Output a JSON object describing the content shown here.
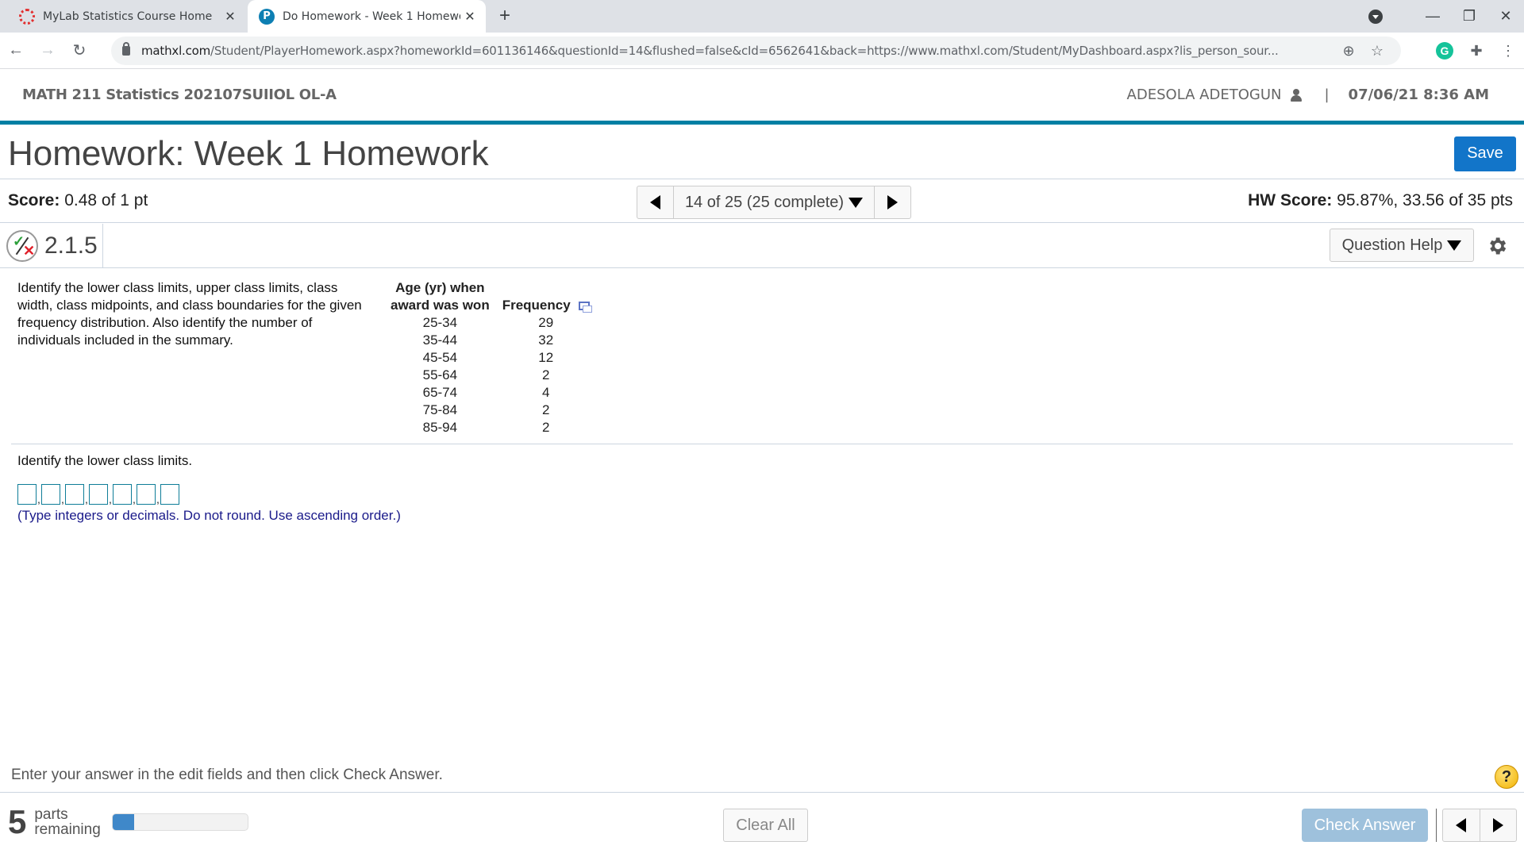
{
  "browser": {
    "tabs": [
      {
        "title": "MyLab Statistics Course Home",
        "icon": "canvas-icon",
        "active": false
      },
      {
        "title": "Do Homework - Week 1 Homework",
        "icon": "pearson-icon",
        "active": true
      }
    ],
    "new_tab": "+",
    "url_host": "mathxl.com",
    "url_path": "/Student/PlayerHomework.aspx?homeworkId=601136146&questionId=14&flushed=false&cId=6562641&back=https://www.mathxl.com/Student/MyDashboard.aspx?lis_person_sour..."
  },
  "course": {
    "name": "MATH 211 Statistics 202107SUIIOL OL-A",
    "user": "ADESOLA ADETOGUN",
    "separator": "|",
    "datetime": "07/06/21 8:36 AM"
  },
  "homework": {
    "title": "Homework: Week 1 Homework",
    "save_label": "Save",
    "score_label": "Score:",
    "score_value": "0.48 of 1 pt",
    "question_selector": "14 of 25 (25 complete)",
    "hw_score_label": "HW Score:",
    "hw_score_value": "95.87%, 33.56 of 35 pts"
  },
  "question": {
    "number": "2.1.5",
    "help_label": "Question Help",
    "stem": "Identify the lower class limits, upper class limits, class width, class midpoints, and class boundaries for the given frequency distribution. Also identify the number of individuals included in the summary.",
    "table": {
      "headers": [
        "Age (yr) when award was won",
        "Frequency"
      ],
      "header_lines": [
        [
          "Age (yr) when",
          "award was won"
        ],
        [
          "",
          "Frequency"
        ]
      ],
      "rows": [
        [
          "25-34",
          "29"
        ],
        [
          "35-44",
          "32"
        ],
        [
          "45-54",
          "12"
        ],
        [
          "55-64",
          "2"
        ],
        [
          "65-74",
          "4"
        ],
        [
          "75-84",
          "2"
        ],
        [
          "85-94",
          "2"
        ]
      ]
    },
    "part_prompt": "Identify the lower class limits.",
    "answer_fields": [
      "",
      "",
      "",
      "",
      "",
      "",
      ""
    ],
    "answer_separator": ",",
    "hint": "(Type integers or decimals. Do not round. Use ascending order.)"
  },
  "footer": {
    "instruction": "Enter your answer in the edit fields and then click Check Answer.",
    "help_symbol": "?",
    "parts_remaining": "5",
    "parts_label_1": "parts",
    "parts_label_2": "remaining",
    "progress_fraction": 0.16,
    "clear_label": "Clear All",
    "check_label": "Check Answer"
  },
  "colors": {
    "accent_bar": "#007fa3",
    "save_button": "#1275c9",
    "check_button_disabled": "#9ec1dc",
    "progress_fill": "#3f88c9",
    "hint_text": "#1a1a8a",
    "answer_box_border": "#0e7d98"
  }
}
